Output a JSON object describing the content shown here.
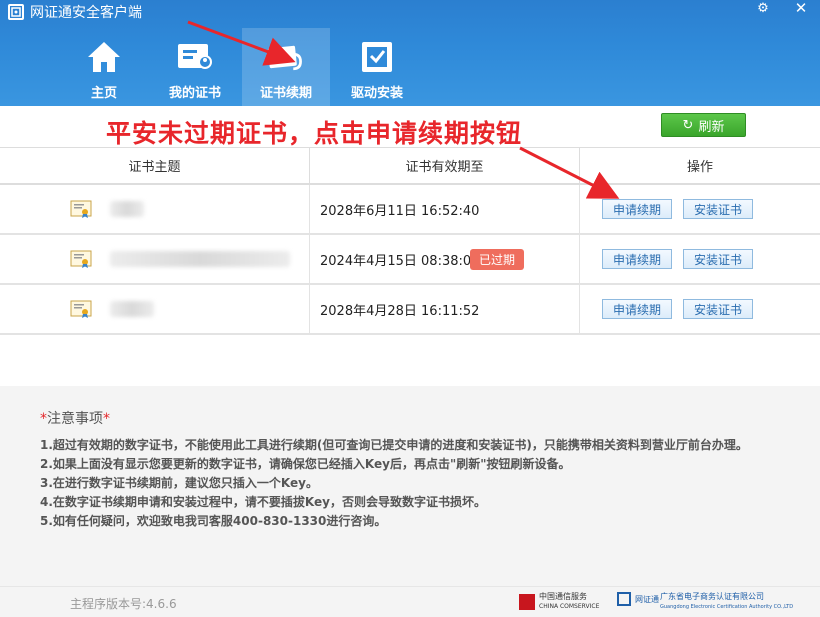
{
  "app": {
    "title": "网证通安全客户端"
  },
  "nav": [
    {
      "label": "主页",
      "icon": "home-icon"
    },
    {
      "label": "我的证书",
      "icon": "my-cert-icon"
    },
    {
      "label": "证书续期",
      "icon": "cert-renew-icon",
      "active": true
    },
    {
      "label": "驱动安装",
      "icon": "driver-install-icon"
    }
  ],
  "annotation": {
    "text": "平安未过期证书，点击申请续期按钮",
    "color": "#e8262b"
  },
  "toolbar": {
    "refresh_label": "刷新"
  },
  "table": {
    "headers": [
      "证书主题",
      "证书有效期至",
      "操作"
    ],
    "rows": [
      {
        "expiry": "2028年6月11日 16:52:40",
        "expired": false,
        "renew_label": "申请续期",
        "install_label": "安装证书"
      },
      {
        "expiry": "2024年4月15日 08:38:08",
        "expired": true,
        "expired_label": "已过期",
        "renew_label": "申请续期",
        "install_label": "安装证书"
      },
      {
        "expiry": "2028年4月28日 16:11:52",
        "expired": false,
        "renew_label": "申请续期",
        "install_label": "安装证书"
      }
    ]
  },
  "notes": {
    "title_star": "*",
    "title": "注意事项",
    "items": [
      "1.超过有效期的数字证书，不能使用此工具进行续期(但可查询已提交申请的进度和安装证书)，只能携带相关资料到营业厅前台办理。",
      "2.如果上面没有显示您要更新的数字证书，请确保您已经插入Key后，再点击\"刷新\"按钮刷新设备。",
      "3.在进行数字证书续期前，建议您只插入一个Key。",
      "4.在数字证书续期申请和安装过程中，请不要插拔Key，否则会导致数字证书损坏。",
      "5.如有任何疑问，欢迎致电我司客服400-830-1330进行咨询。"
    ]
  },
  "footer": {
    "version": "主程序版本号:4.6.6",
    "logo1_cn": "中国通信服务",
    "logo1_en": "CHINA COMSERVICE",
    "logo2": "网证通",
    "logo3_cn": "广东省电子商务认证有限公司",
    "logo3_en": "Guangdong Electronic Certification Authority CO.,LTD"
  },
  "colors": {
    "accent": "#2f8ad9",
    "refresh": "#3aa52b",
    "expired": "#ef6d5d"
  }
}
